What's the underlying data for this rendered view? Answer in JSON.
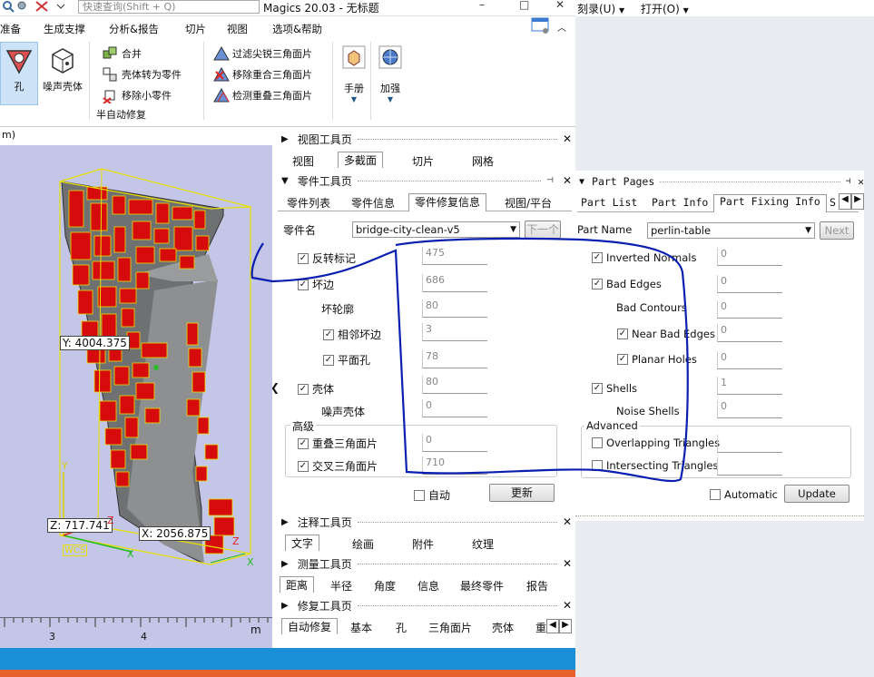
{
  "titlebar": {
    "search_placeholder": "快速查询(Shift + Q)",
    "app_title": "Magics 20.03 - 无标题",
    "minimize": "–",
    "maximize": "□",
    "close": "✕"
  },
  "menu": {
    "tabs": [
      "准备",
      "生成支撑",
      "分析&报告",
      "切片",
      "视图",
      "选项&帮助"
    ]
  },
  "ribbon": {
    "big_buttons": [
      "孔",
      "噪声壳体"
    ],
    "small_buttons": [
      "合并",
      "壳体转为零件",
      "移除小零件"
    ],
    "group_label": "半自动修复",
    "triangle_buttons": [
      "过滤尖锐三角面片",
      "移除重合三角面片",
      "检测重叠三角面片"
    ],
    "manual_label": "手册",
    "accelerate_label": "加强"
  },
  "viewport": {
    "header": "m)",
    "y_label": "Y: 4004.375",
    "z_label": "Z: 717.741",
    "x_label": "X: 2056.875",
    "wcs": "WCS",
    "axis_x": "X",
    "axis_y": "Y",
    "axis_z": "Z",
    "ruler": {
      "ticks": [
        "3",
        "4"
      ],
      "unit": "m"
    }
  },
  "view_toolbar": {
    "title": "视图工具页",
    "tabs": [
      "视图",
      "多截面",
      "切片",
      "网格"
    ]
  },
  "part_toolbar": {
    "title": "零件工具页",
    "tabs": [
      "零件列表",
      "零件信息",
      "零件修复信息",
      "视图/平台"
    ],
    "part_name_label": "零件名",
    "part_name_value": "bridge-city-clean-v5",
    "next_label": "下一个",
    "rows": [
      {
        "label": "反转标记",
        "value": "475"
      },
      {
        "label": "坏边",
        "value": "686"
      },
      {
        "label": "坏轮廓",
        "value": "80"
      },
      {
        "label": "相邻坏边",
        "value": "3"
      },
      {
        "label": "平面孔",
        "value": "78"
      },
      {
        "label": "壳体",
        "value": "80"
      },
      {
        "label": "噪声壳体",
        "value": "0"
      }
    ],
    "advanced_label": "高级",
    "advanced_rows": [
      {
        "label": "重叠三角面片",
        "value": "0"
      },
      {
        "label": "交叉三角面片",
        "value": "710"
      }
    ],
    "auto_label": "自动",
    "update_label": "更新"
  },
  "annot_toolbar": {
    "title": "注释工具页",
    "tabs": [
      "文字",
      "绘画",
      "附件",
      "纹理"
    ]
  },
  "measure_toolbar": {
    "title": "测量工具页",
    "tabs": [
      "距离",
      "半径",
      "角度",
      "信息",
      "最终零件",
      "报告"
    ]
  },
  "fix_toolbar": {
    "title": "修复工具页",
    "tabs": [
      "自动修复",
      "基本",
      "孔",
      "三角面片",
      "壳体",
      "重"
    ]
  },
  "right_menu": {
    "items": [
      "刻录(U)",
      "打开(O)"
    ]
  },
  "part_pages": {
    "title": "Part Pages",
    "tabs": [
      "Part List",
      "Part Info",
      "Part Fixing Info",
      "S"
    ],
    "part_name_label": "Part Name",
    "part_name_value": "perlin-table",
    "next_label": "Next",
    "rows": [
      {
        "label": "Inverted Normals",
        "value": "0"
      },
      {
        "label": "Bad Edges",
        "value": "0"
      },
      {
        "label": "Bad Contours",
        "value": "0"
      },
      {
        "label": "Near Bad Edges",
        "value": "0"
      },
      {
        "label": "Planar Holes",
        "value": "0"
      },
      {
        "label": "Shells",
        "value": "1"
      },
      {
        "label": "Noise Shells",
        "value": "0"
      }
    ],
    "advanced_label": "Advanced",
    "advanced_rows": [
      {
        "label": "Overlapping Triangles",
        "value": ""
      },
      {
        "label": "Intersecting Triangles",
        "value": ""
      }
    ],
    "auto_label": "Automatic",
    "update_label": "Update"
  },
  "colors": {
    "viewport_bg": "#c3c6e6",
    "status_blue": "#1a8fd8",
    "taskbar_orange": "#e6612c",
    "annotation_blue": "#0a1fb0"
  }
}
